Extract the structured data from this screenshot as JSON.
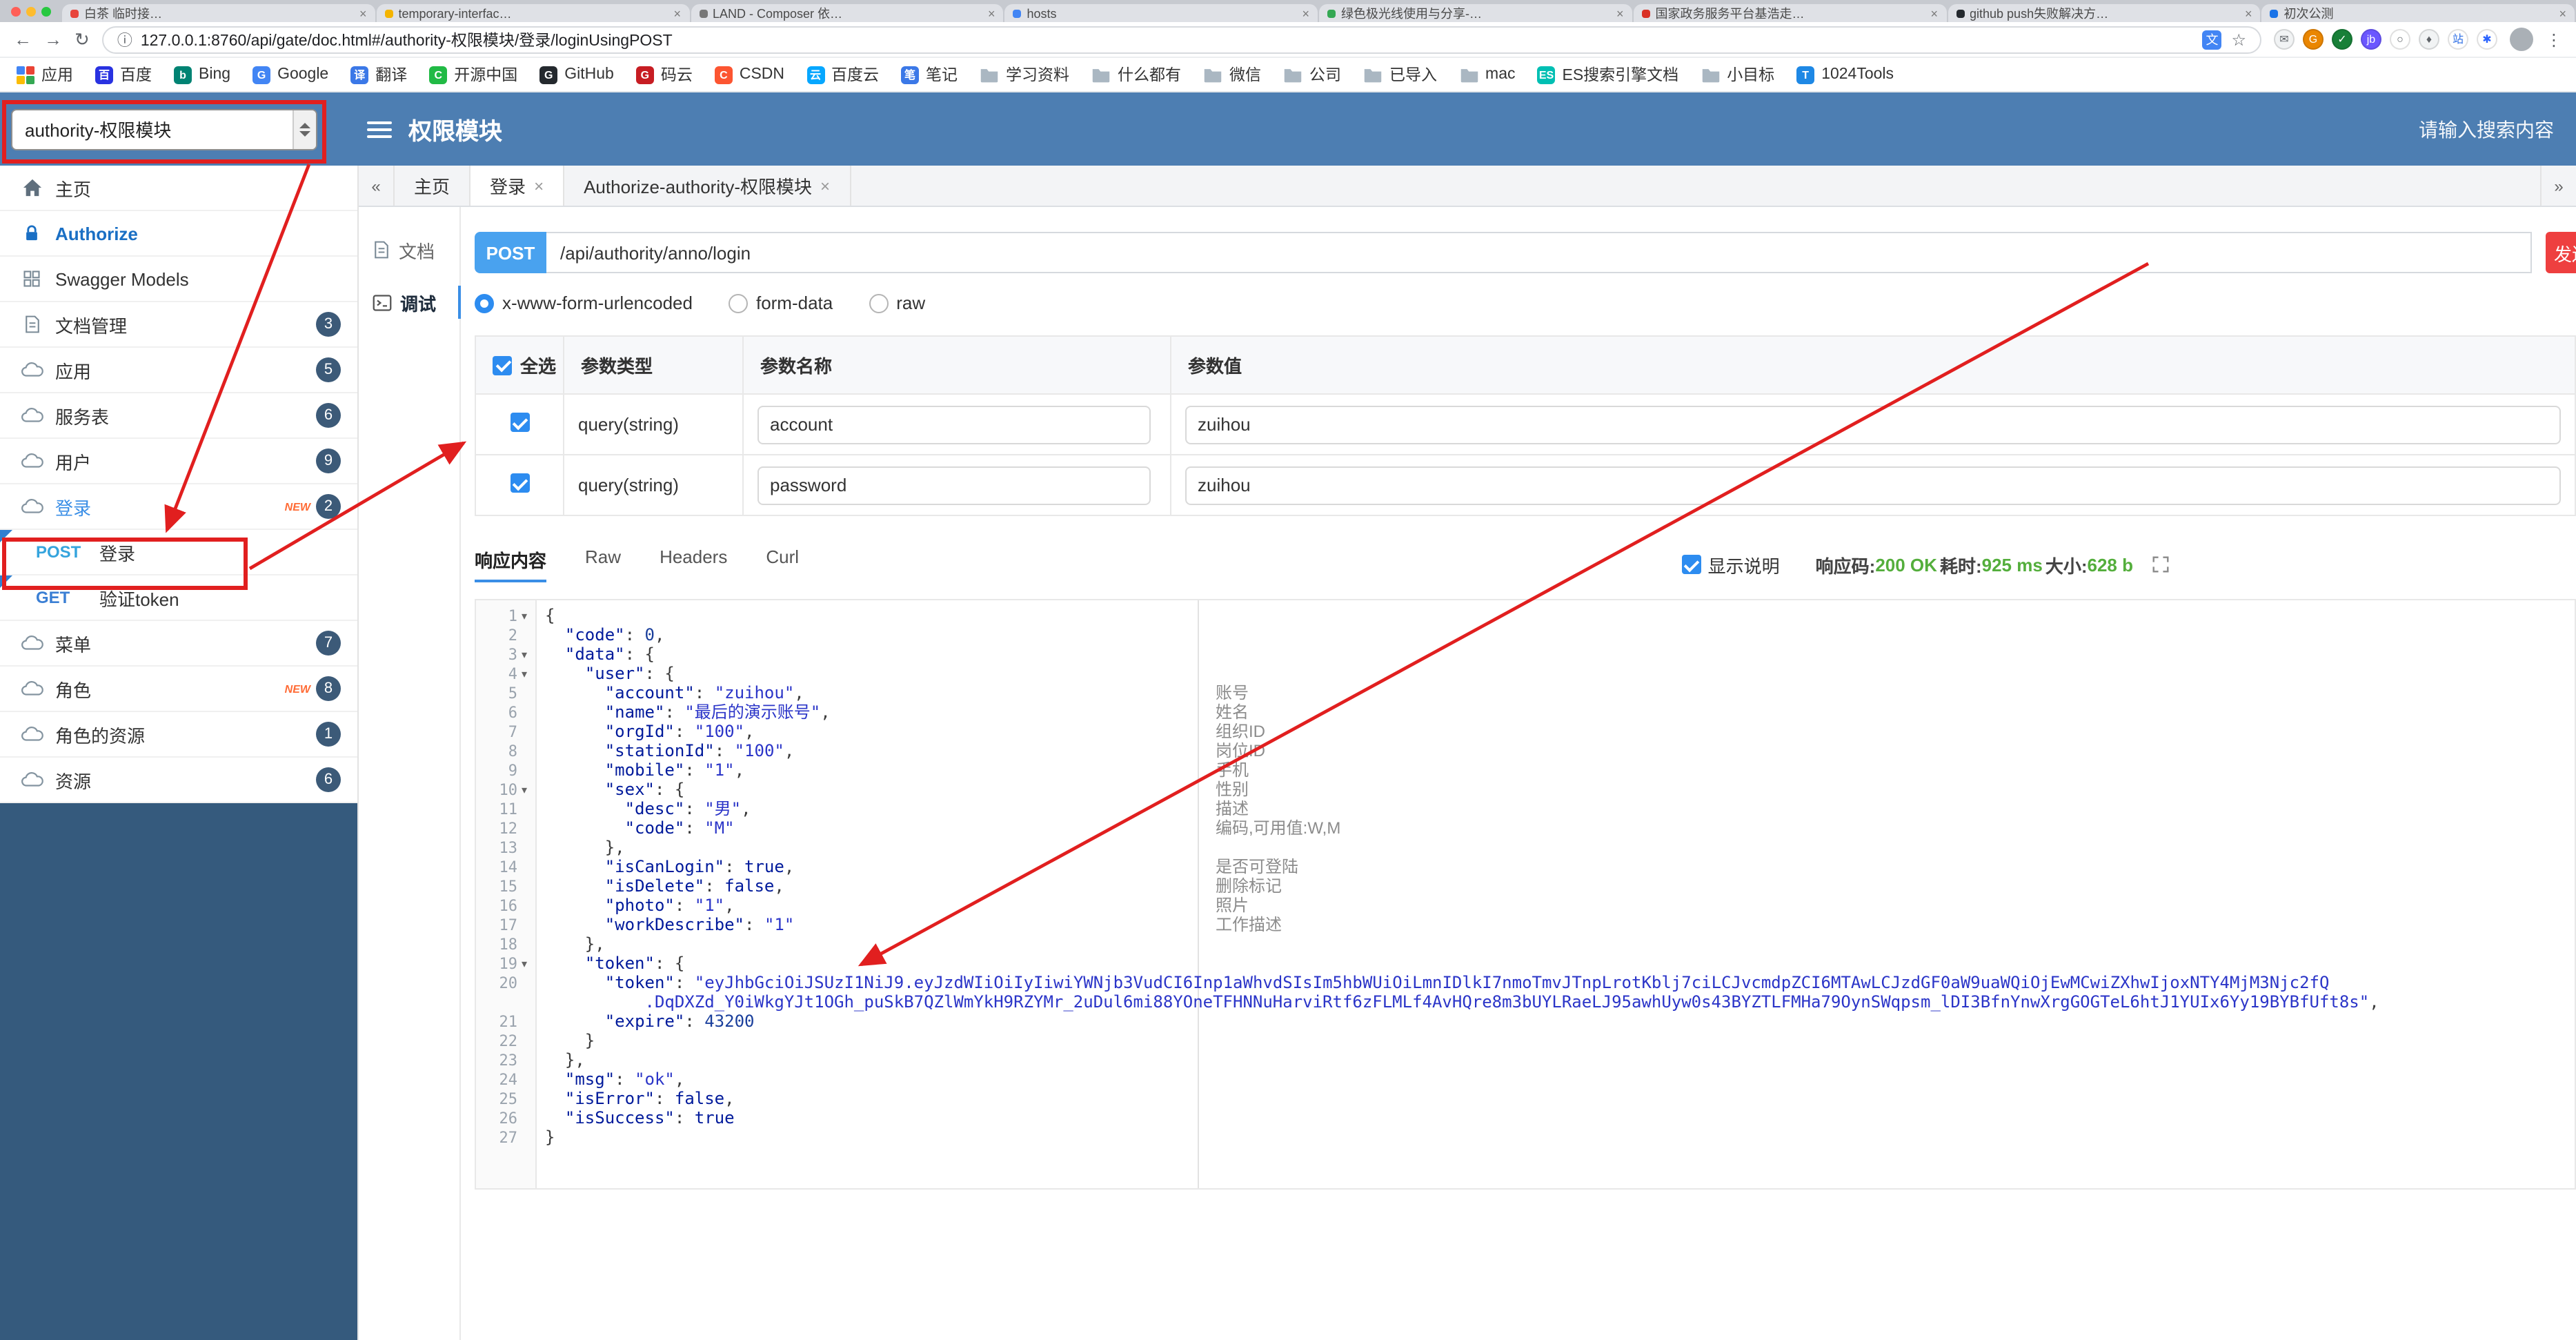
{
  "browser": {
    "tabs": [
      {
        "title": "白茶 临时接…",
        "favicon_color": "#e8453c"
      },
      {
        "title": "temporary-interfac…",
        "favicon_color": "#f4b400"
      },
      {
        "title": "LAND - Composer 依…",
        "favicon_color": "#777777"
      },
      {
        "title": "hosts",
        "favicon_color": "#4285f4"
      },
      {
        "title": "绿色极光线使用与分享-…",
        "favicon_color": "#34a853"
      },
      {
        "title": "国家政务服务平台基浩走…",
        "favicon_color": "#d93025"
      },
      {
        "title": "github push失败解决方…",
        "favicon_color": "#24292e"
      },
      {
        "title": "初次公测",
        "favicon_color": "#1a73e8"
      }
    ],
    "address": {
      "url": "127.0.0.1:8760/api/gate/doc.html#/authority-权限模块/登录/loginUsingPOST"
    },
    "toolbar_icons": [
      {
        "name": "extension-mail-icon",
        "glyph": "✉",
        "bg": "#f1f3f4",
        "fg": "#5f6368"
      },
      {
        "name": "extension-g-icon",
        "glyph": "G",
        "bg": "#ea8600",
        "fg": "#ffffff"
      },
      {
        "name": "extension-check-icon",
        "glyph": "✓",
        "bg": "#188038",
        "fg": "#ffffff"
      },
      {
        "name": "extension-jb-icon",
        "glyph": "jb",
        "bg": "#6b57ff",
        "fg": "#ffffff"
      },
      {
        "name": "extension-circle-icon",
        "glyph": "○",
        "bg": "#ffffff",
        "fg": "#5f6368"
      },
      {
        "name": "extension-shield-icon",
        "glyph": "♦",
        "bg": "#f1f3f4",
        "fg": "#5f6368"
      },
      {
        "name": "extension-zhan-icon",
        "glyph": "站",
        "bg": "#ffffff",
        "fg": "#2f6fe4"
      },
      {
        "name": "extension-asterisk-icon",
        "glyph": "✱",
        "bg": "#ffffff",
        "fg": "#2962ff"
      }
    ],
    "bookmarks": [
      {
        "label": "应用",
        "kind": "apps"
      },
      {
        "label": "百度",
        "kind": "chip",
        "letter": "百",
        "color": "#2932e1"
      },
      {
        "label": "Bing",
        "kind": "chip",
        "letter": "b",
        "color": "#008373"
      },
      {
        "label": "Google",
        "kind": "chip",
        "letter": "G",
        "color": "#4285f4"
      },
      {
        "label": "翻译",
        "kind": "chip",
        "letter": "译",
        "color": "#3b78e7"
      },
      {
        "label": "开源中国",
        "kind": "chip",
        "letter": "C",
        "color": "#21ba45"
      },
      {
        "label": "GitHub",
        "kind": "chip",
        "letter": "G",
        "color": "#24292e"
      },
      {
        "label": "码云",
        "kind": "chip",
        "letter": "G",
        "color": "#c71d23"
      },
      {
        "label": "CSDN",
        "kind": "chip",
        "letter": "C",
        "color": "#fc5531"
      },
      {
        "label": "百度云",
        "kind": "chip",
        "letter": "云",
        "color": "#06a7ff"
      },
      {
        "label": "笔记",
        "kind": "chip",
        "letter": "笔",
        "color": "#3b78e7"
      },
      {
        "label": "学习资料",
        "kind": "folder"
      },
      {
        "label": "什么都有",
        "kind": "folder"
      },
      {
        "label": "微信",
        "kind": "folder"
      },
      {
        "label": "公司",
        "kind": "folder"
      },
      {
        "label": "已导入",
        "kind": "folder"
      },
      {
        "label": "mac",
        "kind": "folder"
      },
      {
        "label": "ES搜索引擎文档",
        "kind": "chip",
        "letter": "ES",
        "color": "#00bfb3"
      },
      {
        "label": "小目标",
        "kind": "folder"
      },
      {
        "label": "1024Tools",
        "kind": "chip",
        "letter": "T",
        "color": "#1e88e5"
      }
    ]
  },
  "header": {
    "module_select": "authority-权限模块",
    "title": "权限模块",
    "search_placeholder": "请输入搜索内容"
  },
  "sidebar": {
    "items": [
      {
        "icon": "home",
        "label": "主页"
      },
      {
        "icon": "lock",
        "label": "Authorize",
        "style": "authorize"
      },
      {
        "icon": "models",
        "label": "Swagger Models"
      },
      {
        "icon": "doc",
        "label": "文档管理",
        "badge": "3"
      },
      {
        "icon": "cloud",
        "label": "应用",
        "badge": "5"
      },
      {
        "icon": "cloud",
        "label": "服务表",
        "badge": "6"
      },
      {
        "icon": "cloud",
        "label": "用户",
        "badge": "9"
      },
      {
        "icon": "cloud",
        "label": "登录",
        "badge": "2",
        "new": true,
        "active": true
      },
      {
        "type": "api",
        "method": "POST",
        "label": "登录"
      },
      {
        "type": "api",
        "method": "GET",
        "label": "验证token"
      },
      {
        "icon": "cloud",
        "label": "菜单",
        "badge": "7"
      },
      {
        "icon": "cloud",
        "label": "角色",
        "badge": "8",
        "new": true
      },
      {
        "icon": "cloud",
        "label": "角色的资源",
        "badge": "1"
      },
      {
        "icon": "cloud",
        "label": "资源",
        "badge": "6"
      }
    ]
  },
  "doc_tabs": [
    {
      "label": "主页"
    },
    {
      "label": "登录",
      "closable": true,
      "active": true
    },
    {
      "label": "Authorize-authority-权限模块",
      "closable": true
    }
  ],
  "mini_nav": [
    {
      "label": "文档",
      "icon": "doc"
    },
    {
      "label": "调试",
      "icon": "debug",
      "active": true
    }
  ],
  "debug": {
    "method": "POST",
    "url": "/api/authority/anno/login",
    "send_label": "发送",
    "content_types": [
      {
        "label": "x-www-form-urlencoded",
        "selected": true
      },
      {
        "label": "form-data"
      },
      {
        "label": "raw"
      }
    ],
    "param_table": {
      "headers": [
        "全选",
        "参数类型",
        "参数名称",
        "参数值"
      ],
      "rows": [
        {
          "checked": true,
          "type": "query(string)",
          "name": "account",
          "value": "zuihou"
        },
        {
          "checked": true,
          "type": "query(string)",
          "name": "password",
          "value": "zuihou"
        }
      ]
    },
    "response": {
      "tabs": [
        {
          "label": "响应内容",
          "active": true
        },
        {
          "label": "Raw"
        },
        {
          "label": "Headers"
        },
        {
          "label": "Curl"
        }
      ],
      "show_desc_label": "显示说明",
      "meta": [
        {
          "label": "响应码:",
          "value": "200 OK"
        },
        {
          "label": "耗时:",
          "value": "925 ms"
        },
        {
          "label": "大小:",
          "value": "628 b"
        }
      ]
    }
  },
  "code": {
    "rows": [
      {
        "n": "1",
        "fold": true,
        "seg": [
          [
            "p",
            "{"
          ]
        ]
      },
      {
        "n": "2",
        "seg": [
          [
            "p",
            "  "
          ],
          [
            "k",
            "\"code\""
          ],
          [
            "p",
            ": "
          ],
          [
            "num",
            "0"
          ],
          [
            "p",
            ","
          ]
        ]
      },
      {
        "n": "3",
        "fold": true,
        "seg": [
          [
            "p",
            "  "
          ],
          [
            "k",
            "\"data\""
          ],
          [
            "p",
            ": {"
          ]
        ]
      },
      {
        "n": "4",
        "fold": true,
        "seg": [
          [
            "p",
            "    "
          ],
          [
            "k",
            "\"user\""
          ],
          [
            "p",
            ": {"
          ]
        ]
      },
      {
        "n": "5",
        "seg": [
          [
            "p",
            "      "
          ],
          [
            "k",
            "\"account\""
          ],
          [
            "p",
            ": "
          ],
          [
            "s",
            "\"zuihou\""
          ],
          [
            "p",
            ","
          ]
        ]
      },
      {
        "n": "6",
        "seg": [
          [
            "p",
            "      "
          ],
          [
            "k",
            "\"name\""
          ],
          [
            "p",
            ": "
          ],
          [
            "s",
            "\"最后的演示账号\""
          ],
          [
            "p",
            ","
          ]
        ]
      },
      {
        "n": "7",
        "seg": [
          [
            "p",
            "      "
          ],
          [
            "k",
            "\"orgId\""
          ],
          [
            "p",
            ": "
          ],
          [
            "s",
            "\"100\""
          ],
          [
            "p",
            ","
          ]
        ]
      },
      {
        "n": "8",
        "seg": [
          [
            "p",
            "      "
          ],
          [
            "k",
            "\"stationId\""
          ],
          [
            "p",
            ": "
          ],
          [
            "s",
            "\"100\""
          ],
          [
            "p",
            ","
          ]
        ]
      },
      {
        "n": "9",
        "seg": [
          [
            "p",
            "      "
          ],
          [
            "k",
            "\"mobile\""
          ],
          [
            "p",
            ": "
          ],
          [
            "s",
            "\"1\""
          ],
          [
            "p",
            ","
          ]
        ]
      },
      {
        "n": "10",
        "fold": true,
        "seg": [
          [
            "p",
            "      "
          ],
          [
            "k",
            "\"sex\""
          ],
          [
            "p",
            ": {"
          ]
        ]
      },
      {
        "n": "11",
        "seg": [
          [
            "p",
            "        "
          ],
          [
            "k",
            "\"desc\""
          ],
          [
            "p",
            ": "
          ],
          [
            "s",
            "\"男\""
          ],
          [
            "p",
            ","
          ]
        ]
      },
      {
        "n": "12",
        "seg": [
          [
            "p",
            "        "
          ],
          [
            "k",
            "\"code\""
          ],
          [
            "p",
            ": "
          ],
          [
            "s",
            "\"M\""
          ]
        ]
      },
      {
        "n": "13",
        "seg": [
          [
            "p",
            "      },"
          ]
        ]
      },
      {
        "n": "14",
        "seg": [
          [
            "p",
            "      "
          ],
          [
            "k",
            "\"isCanLogin\""
          ],
          [
            "p",
            ": "
          ],
          [
            "b",
            "true"
          ],
          [
            "p",
            ","
          ]
        ]
      },
      {
        "n": "15",
        "seg": [
          [
            "p",
            "      "
          ],
          [
            "k",
            "\"isDelete\""
          ],
          [
            "p",
            ": "
          ],
          [
            "b",
            "false"
          ],
          [
            "p",
            ","
          ]
        ]
      },
      {
        "n": "16",
        "seg": [
          [
            "p",
            "      "
          ],
          [
            "k",
            "\"photo\""
          ],
          [
            "p",
            ": "
          ],
          [
            "s",
            "\"1\""
          ],
          [
            "p",
            ","
          ]
        ]
      },
      {
        "n": "17",
        "seg": [
          [
            "p",
            "      "
          ],
          [
            "k",
            "\"workDescribe\""
          ],
          [
            "p",
            ": "
          ],
          [
            "s",
            "\"1\""
          ]
        ]
      },
      {
        "n": "18",
        "seg": [
          [
            "p",
            "    },"
          ]
        ]
      },
      {
        "n": "19",
        "fold": true,
        "seg": [
          [
            "p",
            "    "
          ],
          [
            "k",
            "\"token\""
          ],
          [
            "p",
            ": {"
          ]
        ]
      },
      {
        "n": "20",
        "seg": [
          [
            "p",
            "      "
          ],
          [
            "k",
            "\"token\""
          ],
          [
            "p",
            ": "
          ],
          [
            "s",
            "\"eyJhbGciOiJSUzI1NiJ9.eyJzdWIiOiIyIiwiYWNjb3VudCI6Inp1aWhvdSIsIm5hbWUiOiLmnIDlkI7nmoTmvJTnpLrotKblj7ciLCJvcmdpZCI6MTAwLCJzdGF0aW9uaWQiOjEwMCwiZXhwIjoxNTY4MjM3Njc2fQ"
          ]
        ]
      },
      {
        "n": "",
        "seg": [
          [
            "s",
            "          .DqDXZd_Y0iWkgYJt1OGh_puSkB7QZlWmYkH9RZYMr_2uDul6mi88YOneTFHNNuHarviRtf6zFLMLf4AvHQre8m3bUYLRaeLJ95awhUyw0s43BYZTLFMHa79OynSWqpsm_lDI3BfnYnwXrgGOGTeL6htJ1YUIx6Yy19BYBfUft8s\""
          ],
          [
            "p",
            ","
          ]
        ]
      },
      {
        "n": "21",
        "seg": [
          [
            "p",
            "      "
          ],
          [
            "k",
            "\"expire\""
          ],
          [
            "p",
            ": "
          ],
          [
            "num",
            "43200"
          ]
        ]
      },
      {
        "n": "22",
        "seg": [
          [
            "p",
            "    }"
          ]
        ]
      },
      {
        "n": "23",
        "seg": [
          [
            "p",
            "  },"
          ]
        ]
      },
      {
        "n": "24",
        "seg": [
          [
            "p",
            "  "
          ],
          [
            "k",
            "\"msg\""
          ],
          [
            "p",
            ": "
          ],
          [
            "s",
            "\"ok\""
          ],
          [
            "p",
            ","
          ]
        ]
      },
      {
        "n": "25",
        "seg": [
          [
            "p",
            "  "
          ],
          [
            "k",
            "\"isError\""
          ],
          [
            "p",
            ": "
          ],
          [
            "b",
            "false"
          ],
          [
            "p",
            ","
          ]
        ]
      },
      {
        "n": "26",
        "seg": [
          [
            "p",
            "  "
          ],
          [
            "k",
            "\"isSuccess\""
          ],
          [
            "p",
            ": "
          ],
          [
            "b",
            "true"
          ]
        ]
      },
      {
        "n": "27",
        "seg": [
          [
            "p",
            "}"
          ]
        ]
      }
    ],
    "annotations": [
      {
        "row": 5,
        "text": "账号"
      },
      {
        "row": 6,
        "text": "姓名"
      },
      {
        "row": 7,
        "text": "组织ID"
      },
      {
        "row": 8,
        "text": "岗位ID"
      },
      {
        "row": 9,
        "text": "手机"
      },
      {
        "row": 10,
        "text": "性别"
      },
      {
        "row": 11,
        "text": "描述"
      },
      {
        "row": 12,
        "text": "编码,可用值:W,M"
      },
      {
        "row": 14,
        "text": "是否可登陆"
      },
      {
        "row": 15,
        "text": "删除标记"
      },
      {
        "row": 16,
        "text": "照片"
      },
      {
        "row": 17,
        "text": "工作描述"
      }
    ]
  },
  "colors": {
    "header_blue": "#4d7eb2",
    "sidebar_dark": "#355a7d",
    "post_badge_blue": "#49a2ef",
    "send_red": "#ee3f3f",
    "annotation_red": "#e11f1f",
    "badge_navy": "#3c5a78",
    "accent_blue": "#2d8cf0",
    "success_green": "#54ae3c"
  }
}
